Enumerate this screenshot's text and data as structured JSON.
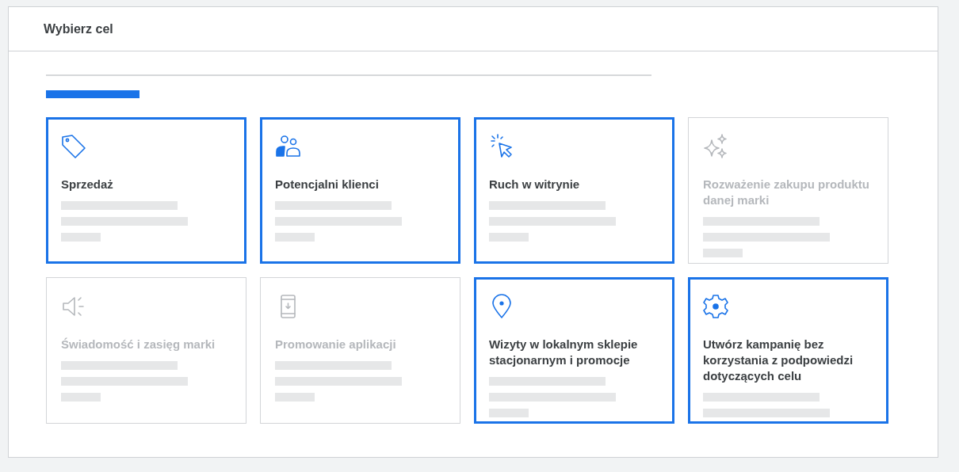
{
  "panel": {
    "title": "Wybierz cel"
  },
  "progress": {
    "level": 0.155
  },
  "goals": [
    {
      "kind": "tag",
      "title": "Sprzedaż",
      "disabled": false
    },
    {
      "kind": "people",
      "title": "Potencjalni klienci",
      "disabled": false
    },
    {
      "kind": "cursor",
      "title": "Ruch w witrynie",
      "disabled": false
    },
    {
      "kind": "sparkles",
      "title": "Rozważenie zakupu produktu danej marki",
      "disabled": true
    },
    {
      "kind": "speaker",
      "title": "Świadomość i zasięg marki",
      "disabled": true
    },
    {
      "kind": "phone",
      "title": "Promowanie aplikacji",
      "disabled": true
    },
    {
      "kind": "pin",
      "title": "Wizyty w lokalnym sklepie stacjonarnym i promocje",
      "disabled": false
    },
    {
      "kind": "gear",
      "title": "Utwórz kampanię bez korzystania z podpowiedzi dotyczących celu",
      "disabled": false
    }
  ]
}
